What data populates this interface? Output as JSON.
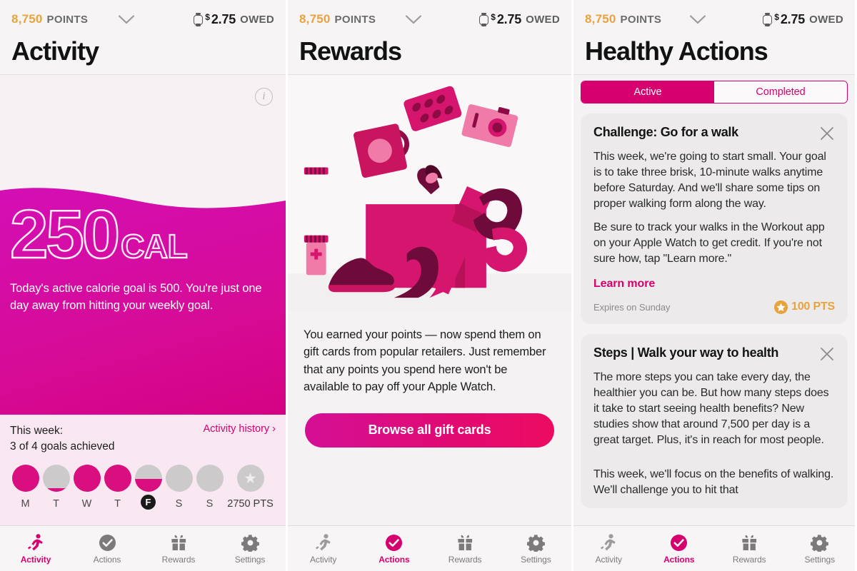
{
  "colors": {
    "brand_magenta": "#d6006e",
    "gradient_start": "#d40f96",
    "gradient_end": "#ec0b60",
    "points_gold": "#e8a33d",
    "inactive_gray": "#7c7a7b",
    "ring_gray": "#cdcacb"
  },
  "header": {
    "points_value": "8,750",
    "points_label": "POINTS",
    "chevron_icon": "chevron-down-icon",
    "watch_icon": "apple-watch-icon",
    "currency_symbol": "$",
    "owed_amount": "2.75",
    "owed_label": "OWED"
  },
  "screens": [
    {
      "id": "activity",
      "title": "Activity",
      "info_icon": "info-icon",
      "calories": {
        "value": "250",
        "unit": "CAL",
        "description": "Today's active calorie goal is 500.\nYou're just one day away from hitting your weekly goal."
      },
      "week": {
        "label": "This week:",
        "goals_text": "3 of 4 goals achieved",
        "history_link": "Activity history ›",
        "days": [
          {
            "label": "M",
            "fill_pct": 100,
            "today": false
          },
          {
            "label": "T",
            "fill_pct": 12,
            "today": false
          },
          {
            "label": "W",
            "fill_pct": 100,
            "today": false
          },
          {
            "label": "T",
            "fill_pct": 100,
            "today": false
          },
          {
            "label": "F",
            "fill_pct": 48,
            "today": true
          },
          {
            "label": "S",
            "fill_pct": 0,
            "today": false
          },
          {
            "label": "S",
            "fill_pct": 0,
            "today": false
          }
        ],
        "total_points": "2750 PTS",
        "total_icon": "star-icon"
      }
    },
    {
      "id": "rewards",
      "title": "Rewards",
      "illustration": "gift-box-illustration",
      "body_text": "You earned your points — now spend them on gift cards from popular retailers. Just remember that any points you spend here won't be available to pay off your Apple Watch.",
      "cta_label": "Browse all gift cards"
    },
    {
      "id": "healthy-actions",
      "title": "Healthy Actions",
      "segments": [
        {
          "label": "Active",
          "selected": true
        },
        {
          "label": "Completed",
          "selected": false
        }
      ],
      "cards": [
        {
          "title": "Challenge: Go for a walk",
          "close_icon": "close-icon",
          "paragraphs": [
            "This week, we're going to start small. Your goal is to take three brisk, 10-minute walks anytime before Saturday. And we'll share some tips on proper walking form along the way.",
            "Be sure to track your walks in the Workout app on your Apple Watch to get credit. If you're not sure how, tap \"Learn more.\""
          ],
          "link_label": "Learn more",
          "expires": "Expires on Sunday",
          "points_badge": "100 PTS",
          "points_icon": "star-badge-icon"
        },
        {
          "title": "Steps | Walk your way to health",
          "close_icon": "close-icon",
          "paragraphs": [
            "The more steps you can take every day, the healthier you can be. But how many steps does it take to start seeing health benefits? New studies show that around 7,500 per day is a great target. Plus, it's in reach for most people.",
            "This week, we'll focus on the benefits of walking. We'll challenge you to hit that"
          ]
        }
      ]
    }
  ],
  "tabbar": {
    "tabs": [
      {
        "label": "Activity",
        "icon": "running-person-icon"
      },
      {
        "label": "Actions",
        "icon": "check-circle-icon"
      },
      {
        "label": "Rewards",
        "icon": "gift-icon"
      },
      {
        "label": "Settings",
        "icon": "gear-icon"
      }
    ],
    "active_by_screen": [
      0,
      1,
      1
    ]
  }
}
